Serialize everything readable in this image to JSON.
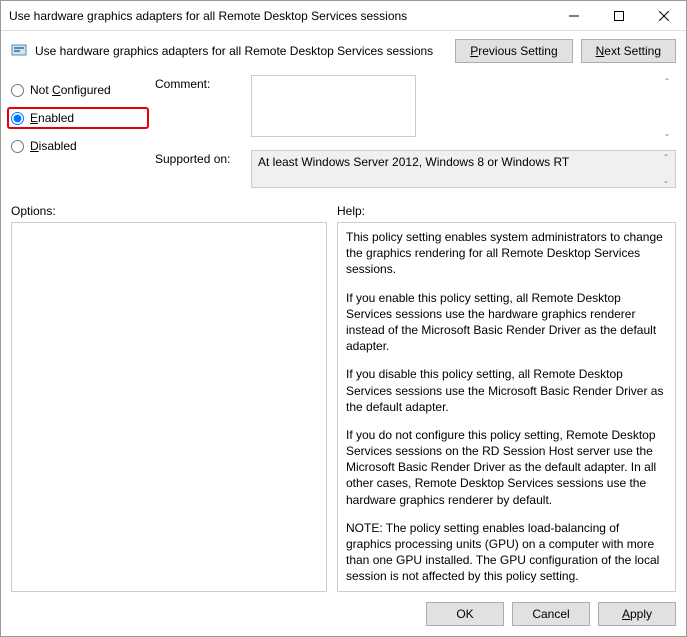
{
  "window": {
    "title": "Use hardware graphics adapters for all Remote Desktop Services sessions"
  },
  "header": {
    "subtitle": "Use hardware graphics adapters for all Remote Desktop Services sessions",
    "prev_btn": "Previous Setting",
    "next_btn": "Next Setting"
  },
  "radios": {
    "not_configured": "Not Configured",
    "enabled": "Enabled",
    "disabled": "Disabled",
    "selected": "enabled"
  },
  "fields": {
    "comment_label": "Comment:",
    "comment_value": "",
    "supported_label": "Supported on:",
    "supported_value": "At least Windows Server 2012, Windows 8 or Windows RT"
  },
  "labels": {
    "options": "Options:",
    "help": "Help:"
  },
  "help": {
    "p1": "This policy setting enables system administrators to change the graphics rendering for all Remote Desktop Services sessions.",
    "p2": "If you enable this policy setting, all Remote Desktop Services sessions use the hardware graphics renderer instead of the Microsoft Basic Render Driver as the default adapter.",
    "p3": "If you disable this policy setting, all Remote Desktop Services sessions use the Microsoft Basic Render Driver as the default adapter.",
    "p4": "If you do not configure this policy setting, Remote Desktop Services sessions on the RD Session Host server use the Microsoft Basic Render Driver as the default adapter. In all other cases, Remote Desktop Services sessions use the hardware graphics renderer by default.",
    "p5": "NOTE: The policy setting enables load-balancing of graphics processing units (GPU) on a computer with more than one GPU installed. The GPU configuration of the local session is not affected by this policy setting."
  },
  "footer": {
    "ok": "OK",
    "cancel": "Cancel",
    "apply": "Apply"
  }
}
